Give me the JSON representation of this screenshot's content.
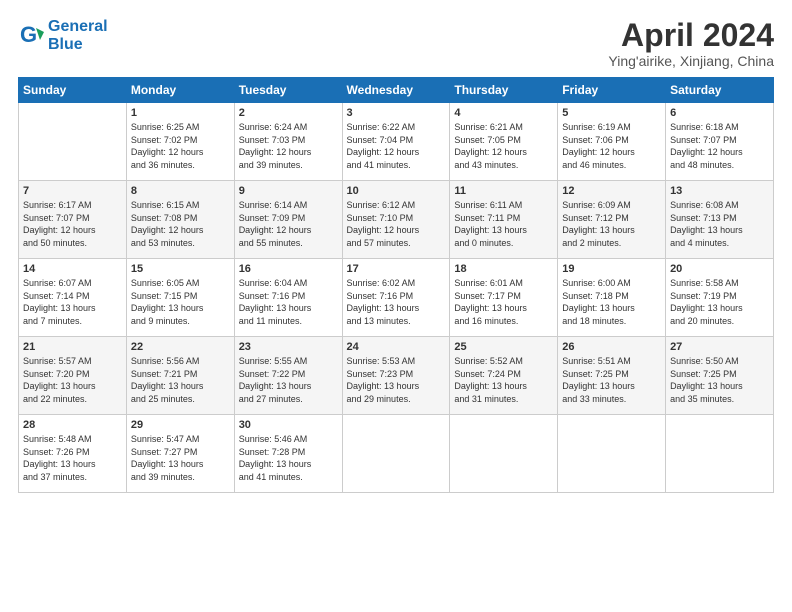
{
  "header": {
    "logo_line1": "General",
    "logo_line2": "Blue",
    "month_title": "April 2024",
    "location": "Ying'airike, Xinjiang, China"
  },
  "days_of_week": [
    "Sunday",
    "Monday",
    "Tuesday",
    "Wednesday",
    "Thursday",
    "Friday",
    "Saturday"
  ],
  "weeks": [
    [
      {
        "day": "",
        "info": ""
      },
      {
        "day": "1",
        "info": "Sunrise: 6:25 AM\nSunset: 7:02 PM\nDaylight: 12 hours\nand 36 minutes."
      },
      {
        "day": "2",
        "info": "Sunrise: 6:24 AM\nSunset: 7:03 PM\nDaylight: 12 hours\nand 39 minutes."
      },
      {
        "day": "3",
        "info": "Sunrise: 6:22 AM\nSunset: 7:04 PM\nDaylight: 12 hours\nand 41 minutes."
      },
      {
        "day": "4",
        "info": "Sunrise: 6:21 AM\nSunset: 7:05 PM\nDaylight: 12 hours\nand 43 minutes."
      },
      {
        "day": "5",
        "info": "Sunrise: 6:19 AM\nSunset: 7:06 PM\nDaylight: 12 hours\nand 46 minutes."
      },
      {
        "day": "6",
        "info": "Sunrise: 6:18 AM\nSunset: 7:07 PM\nDaylight: 12 hours\nand 48 minutes."
      }
    ],
    [
      {
        "day": "7",
        "info": "Sunrise: 6:17 AM\nSunset: 7:07 PM\nDaylight: 12 hours\nand 50 minutes."
      },
      {
        "day": "8",
        "info": "Sunrise: 6:15 AM\nSunset: 7:08 PM\nDaylight: 12 hours\nand 53 minutes."
      },
      {
        "day": "9",
        "info": "Sunrise: 6:14 AM\nSunset: 7:09 PM\nDaylight: 12 hours\nand 55 minutes."
      },
      {
        "day": "10",
        "info": "Sunrise: 6:12 AM\nSunset: 7:10 PM\nDaylight: 12 hours\nand 57 minutes."
      },
      {
        "day": "11",
        "info": "Sunrise: 6:11 AM\nSunset: 7:11 PM\nDaylight: 13 hours\nand 0 minutes."
      },
      {
        "day": "12",
        "info": "Sunrise: 6:09 AM\nSunset: 7:12 PM\nDaylight: 13 hours\nand 2 minutes."
      },
      {
        "day": "13",
        "info": "Sunrise: 6:08 AM\nSunset: 7:13 PM\nDaylight: 13 hours\nand 4 minutes."
      }
    ],
    [
      {
        "day": "14",
        "info": "Sunrise: 6:07 AM\nSunset: 7:14 PM\nDaylight: 13 hours\nand 7 minutes."
      },
      {
        "day": "15",
        "info": "Sunrise: 6:05 AM\nSunset: 7:15 PM\nDaylight: 13 hours\nand 9 minutes."
      },
      {
        "day": "16",
        "info": "Sunrise: 6:04 AM\nSunset: 7:16 PM\nDaylight: 13 hours\nand 11 minutes."
      },
      {
        "day": "17",
        "info": "Sunrise: 6:02 AM\nSunset: 7:16 PM\nDaylight: 13 hours\nand 13 minutes."
      },
      {
        "day": "18",
        "info": "Sunrise: 6:01 AM\nSunset: 7:17 PM\nDaylight: 13 hours\nand 16 minutes."
      },
      {
        "day": "19",
        "info": "Sunrise: 6:00 AM\nSunset: 7:18 PM\nDaylight: 13 hours\nand 18 minutes."
      },
      {
        "day": "20",
        "info": "Sunrise: 5:58 AM\nSunset: 7:19 PM\nDaylight: 13 hours\nand 20 minutes."
      }
    ],
    [
      {
        "day": "21",
        "info": "Sunrise: 5:57 AM\nSunset: 7:20 PM\nDaylight: 13 hours\nand 22 minutes."
      },
      {
        "day": "22",
        "info": "Sunrise: 5:56 AM\nSunset: 7:21 PM\nDaylight: 13 hours\nand 25 minutes."
      },
      {
        "day": "23",
        "info": "Sunrise: 5:55 AM\nSunset: 7:22 PM\nDaylight: 13 hours\nand 27 minutes."
      },
      {
        "day": "24",
        "info": "Sunrise: 5:53 AM\nSunset: 7:23 PM\nDaylight: 13 hours\nand 29 minutes."
      },
      {
        "day": "25",
        "info": "Sunrise: 5:52 AM\nSunset: 7:24 PM\nDaylight: 13 hours\nand 31 minutes."
      },
      {
        "day": "26",
        "info": "Sunrise: 5:51 AM\nSunset: 7:25 PM\nDaylight: 13 hours\nand 33 minutes."
      },
      {
        "day": "27",
        "info": "Sunrise: 5:50 AM\nSunset: 7:25 PM\nDaylight: 13 hours\nand 35 minutes."
      }
    ],
    [
      {
        "day": "28",
        "info": "Sunrise: 5:48 AM\nSunset: 7:26 PM\nDaylight: 13 hours\nand 37 minutes."
      },
      {
        "day": "29",
        "info": "Sunrise: 5:47 AM\nSunset: 7:27 PM\nDaylight: 13 hours\nand 39 minutes."
      },
      {
        "day": "30",
        "info": "Sunrise: 5:46 AM\nSunset: 7:28 PM\nDaylight: 13 hours\nand 41 minutes."
      },
      {
        "day": "",
        "info": ""
      },
      {
        "day": "",
        "info": ""
      },
      {
        "day": "",
        "info": ""
      },
      {
        "day": "",
        "info": ""
      }
    ]
  ]
}
